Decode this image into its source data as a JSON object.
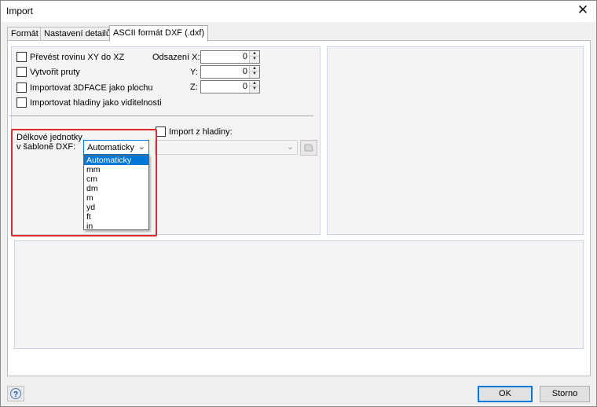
{
  "window": {
    "title": "Import",
    "close_icon": "close-icon"
  },
  "tabs": [
    {
      "label": "Formát",
      "active": false
    },
    {
      "label": "Nastavení detailů",
      "active": false
    },
    {
      "label": "ASCII formát DXF (.dxf)",
      "active": true
    }
  ],
  "options": {
    "convert_plane": {
      "label": "Převést rovinu XY do XZ",
      "checked": false
    },
    "create_members": {
      "label": "Vytvořit pruty",
      "checked": false
    },
    "import_3dface": {
      "label": "Importovat 3DFACE jako plochu",
      "checked": false
    },
    "import_layers_visibility": {
      "label": "Importovat hladiny jako viditelnosti",
      "checked": false
    }
  },
  "offset": {
    "label_x": "Odsazení X:",
    "label_y": "Y:",
    "label_z": "Z:",
    "x_value": "0",
    "y_value": "0",
    "z_value": "0"
  },
  "units": {
    "label_line1": "Délkové jednotky",
    "label_line2": "v šabloně DXF:",
    "selected": "Automaticky",
    "options": [
      "Automaticky",
      "mm",
      "cm",
      "dm",
      "m",
      "yd",
      "ft",
      "in"
    ]
  },
  "import_from_layer": {
    "label": "Import z hladiny:",
    "checked": false,
    "value": ""
  },
  "buttons": {
    "ok": "OK",
    "cancel": "Storno"
  },
  "colors": {
    "accent": "#0078d7",
    "highlight": "#e02a2a",
    "group_border": "#c9d5e4"
  }
}
